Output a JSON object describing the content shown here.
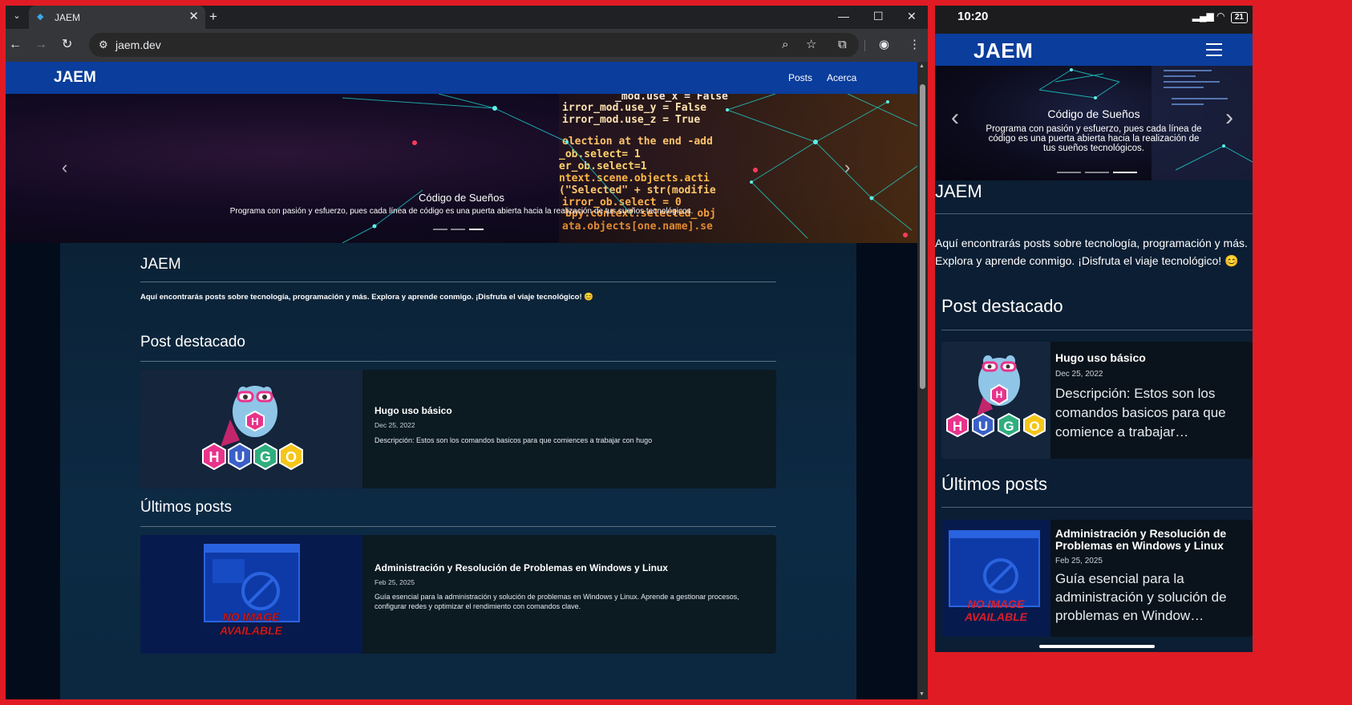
{
  "browser": {
    "tab_title": "JAEM",
    "url": "jaem.dev",
    "icons": [
      "tab-list-icon",
      "close-icon",
      "plus-icon",
      "minimize-icon",
      "maximize-icon",
      "back-icon",
      "forward-icon",
      "reload-icon",
      "site-info-icon",
      "zoom-icon",
      "star-icon",
      "extensions-icon",
      "profile-icon",
      "menu-icon"
    ]
  },
  "site": {
    "brand": "JAEM",
    "nav": [
      "Posts",
      "Acerca"
    ],
    "hero": {
      "title": "Código de Sueños",
      "text": "Programa con pasión y esfuerzo, pues cada línea de código es una puerta abierta hacia la realización de tus sueños tecnológicos.",
      "code_lines": [
        "_mod.use_x = False",
        "irror_mod.use_y = False",
        "irror_mod.use_z = True",
        "election at the end -add",
        "_ob.select= 1",
        "er_ob.select=1",
        "ntext.scene.objects.acti",
        "(\"Selected\" + str(modifie",
        "irror_ob.select = 0",
        "bpy.context.selected_obj",
        "ata.objects[one.name].se"
      ]
    },
    "intro_title": "JAEM",
    "intro_text": "Aquí encontrarás posts sobre tecnología, programación y más. Explora y aprende conmigo. ¡Disfruta el viaje tecnológico! 😊",
    "featured_title": "Post destacado",
    "latest_title": "Últimos posts",
    "featured_post": {
      "title": "Hugo uso básico",
      "date": "Dec 25, 2022",
      "description": "Descripción: Estos son los comandos basicos para que comiences a trabajar con hugo",
      "mobile_description": "Descripción: Estos son los comandos basicos para que comience a trabajar…",
      "logo_letters": [
        "H",
        "U",
        "G",
        "O"
      ],
      "mascot_letter": "H"
    },
    "latest_post": {
      "title": "Administración y Resolución de Problemas en Windows y Linux",
      "date": "Feb 25, 2025",
      "description": "Guía esencial para la administración y solución de problemas en Windows y Linux. Aprende a gestionar procesos, configurar redes y optimizar el rendimiento con comandos clave.",
      "mobile_description": "Guía esencial para la administración y solución de problemas en Window…",
      "no_image_line1": "NO IMAGE",
      "no_image_line2": "AVAILABLE"
    }
  },
  "phone": {
    "time": "10:20",
    "battery": "21"
  },
  "colors": {
    "frame": "#e01b24",
    "navbar": "#0a3d9c",
    "hugo_pink": "#e8338b",
    "hugo_blue": "#3a5fc7",
    "hugo_green": "#2fae7e",
    "hugo_yellow": "#f5c518"
  }
}
